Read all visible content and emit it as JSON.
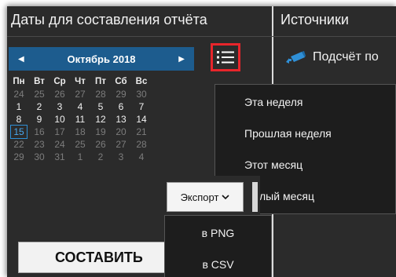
{
  "dates_panel": {
    "title": "Даты для составления отчёта"
  },
  "sources_panel": {
    "title": "Источники",
    "item_label": "Подсчёт по"
  },
  "calendar": {
    "month_label": "Октябрь 2018",
    "prev_icon": "triangle-left",
    "next_icon": "triangle-right",
    "weekdays": [
      "Пн",
      "Вт",
      "Ср",
      "Чт",
      "Пт",
      "Сб",
      "Вс"
    ],
    "weeks": [
      [
        "24",
        "25",
        "26",
        "27",
        "28",
        "29",
        "30"
      ],
      [
        "1",
        "2",
        "3",
        "4",
        "5",
        "6",
        "7"
      ],
      [
        "8",
        "9",
        "10",
        "11",
        "12",
        "13",
        "14"
      ],
      [
        "15",
        "16",
        "17",
        "18",
        "19",
        "20",
        "21"
      ],
      [
        "22",
        "23",
        "24",
        "25",
        "26",
        "27",
        "28"
      ],
      [
        "29",
        "30",
        "31",
        "1",
        "2",
        "3",
        "4"
      ]
    ],
    "today": "15"
  },
  "list_button": {
    "icon": "list-icon",
    "highlight_color": "#e8252b"
  },
  "range_menu": {
    "items": [
      "Эта неделя",
      "Прошлая неделя",
      "Этот месяц",
      "ошлый месяц"
    ]
  },
  "export": {
    "label": "Экспорт",
    "chevron": "chevron-down-icon",
    "items": [
      "в PNG",
      "в CSV"
    ]
  },
  "build_button": {
    "label": "СОСТАВИТЬ"
  },
  "colors": {
    "background": "#2b2b2b",
    "accent": "#1d5c8e",
    "today_outline": "#2f8fd6",
    "camera_icon": "#2f8fd6"
  }
}
